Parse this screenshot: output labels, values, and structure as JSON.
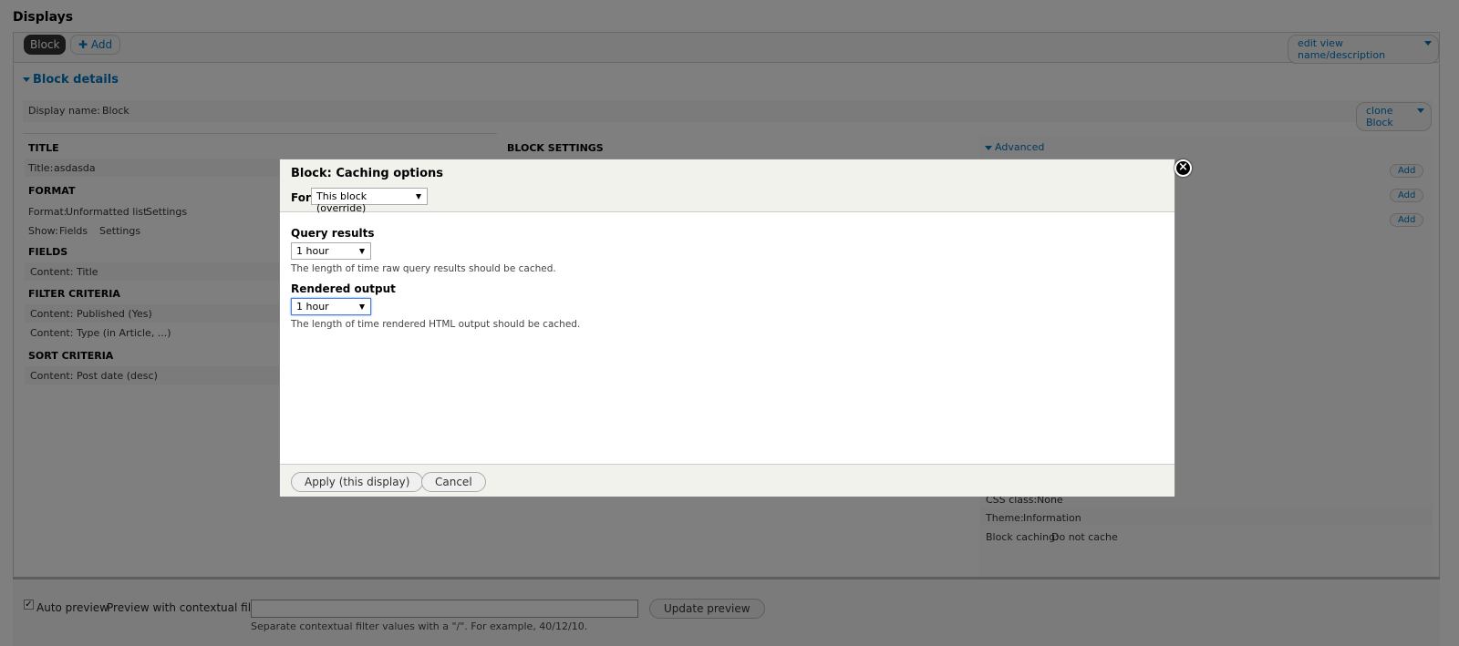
{
  "page": {
    "title": "Displays",
    "tabs": [
      "Block",
      "Add"
    ],
    "edit_view_label": "edit view name/description",
    "block_details_label": "Block details",
    "display_name_label": "Display name:",
    "display_name_value": "Block",
    "clone_label": "clone Block",
    "col1": {
      "title_head": "TITLE",
      "title_label": "Title:",
      "title_value": "asdasda",
      "format_head": "FORMAT",
      "format_label": "Format:",
      "format_value": "Unformatted list",
      "settings": "Settings",
      "show_label": "Show:",
      "show_value": "Fields",
      "fields_head": "FIELDS",
      "field_1": "Content: Title",
      "filter_head": "FILTER CRITERIA",
      "filter_1": "Content: Published (Yes)",
      "filter_2": "Content: Type (in Article, ...)",
      "sort_head": "SORT CRITERIA",
      "sort_1": "Content: Post date (desc)"
    },
    "col2": {
      "head": "BLOCK SETTINGS"
    },
    "col3": {
      "advanced": "Advanced",
      "add": "Add",
      "css_label": "CSS class:",
      "css_value": "None",
      "theme_label": "Theme:",
      "theme_value": "Information",
      "caching_label": "Block caching:",
      "caching_value": "Do not cache"
    },
    "preview": {
      "auto_preview": "Auto preview",
      "contextual_label": "Preview with contextual filters:",
      "update_button": "Update preview",
      "help": "Separate contextual filter values with a \"/\". For example, 40/12/10."
    }
  },
  "modal": {
    "title": "Block: Caching options",
    "for_label": "For",
    "for_value": "This block (override)",
    "query_label": "Query results",
    "query_value": "1 hour",
    "query_desc": "The length of time raw query results should be cached.",
    "output_label": "Rendered output",
    "output_value": "1 hour",
    "output_desc": "The length of time rendered HTML output should be cached.",
    "apply_button": "Apply (this display)",
    "cancel_button": "Cancel",
    "close_icon": "close-icon"
  }
}
